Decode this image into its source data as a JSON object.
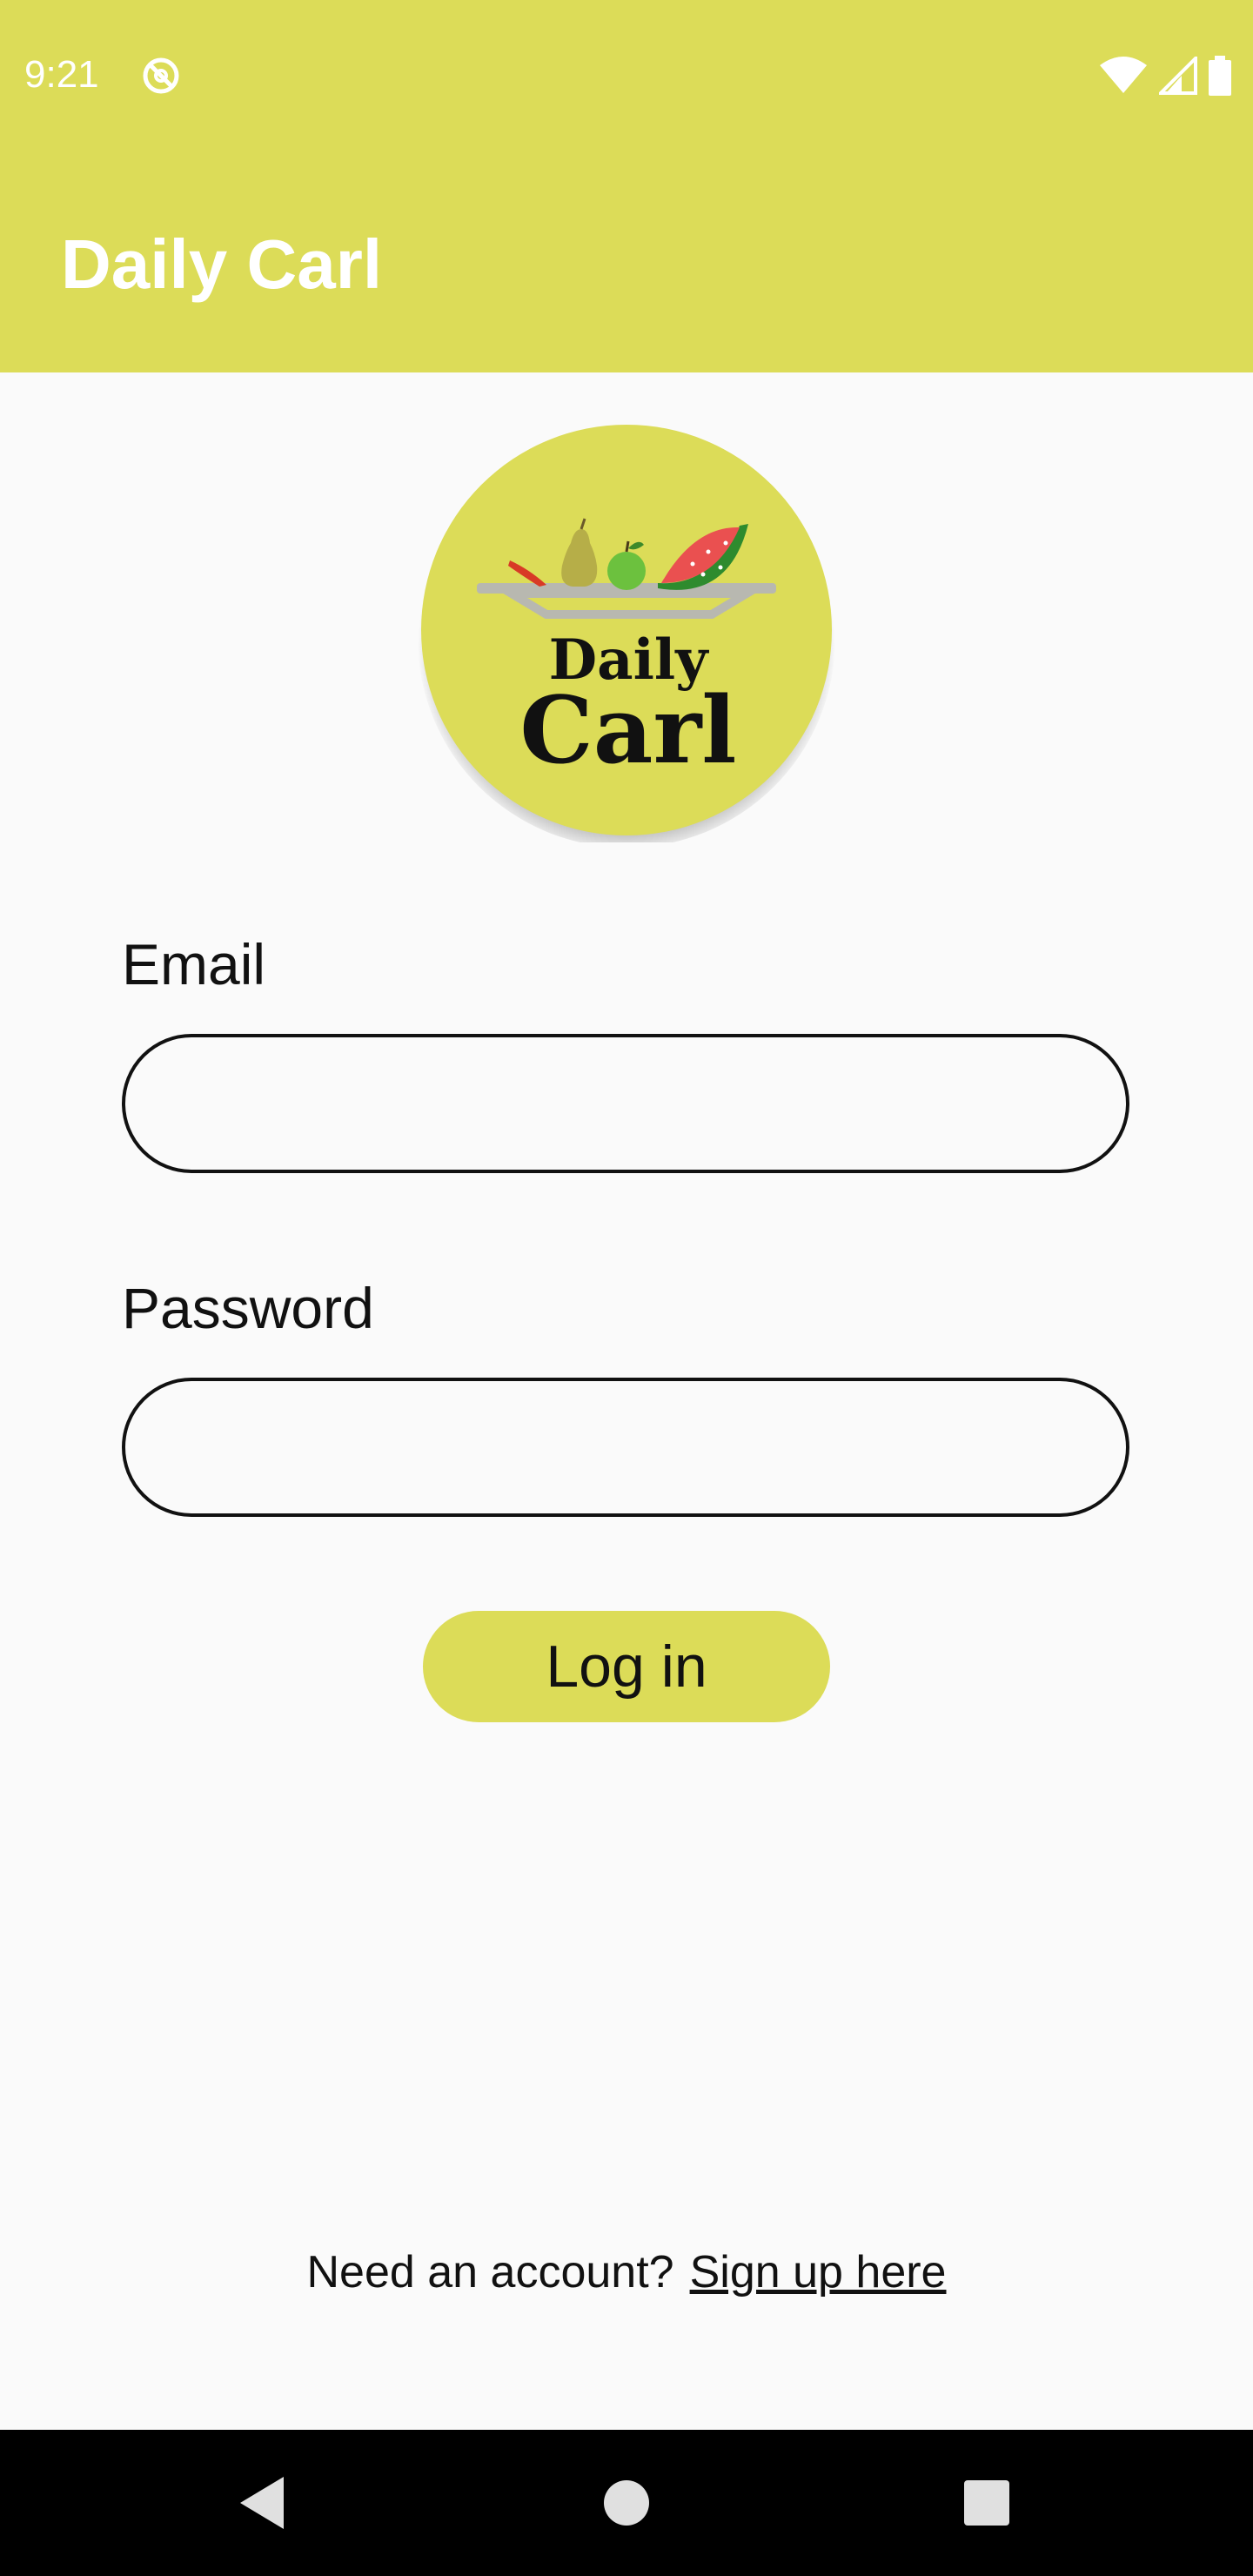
{
  "status_bar": {
    "time": "9:21",
    "app_icon": "sync-disabled-icon",
    "icons": [
      "wifi-icon",
      "cell-signal-icon",
      "battery-icon"
    ],
    "color": "#dcdc58"
  },
  "app_bar": {
    "title": "Daily Carl",
    "color": "#dcdc58"
  },
  "logo": {
    "line1": "Daily",
    "line2": "Carl",
    "color": "#dcdc58"
  },
  "form": {
    "email_label": "Email",
    "email_value": "",
    "password_label": "Password",
    "password_value": "",
    "login_label": "Log in"
  },
  "footer": {
    "prompt": "Need an account?",
    "signup_link": "Sign up here"
  },
  "nav_bar": {
    "buttons": [
      "back-icon",
      "home-icon",
      "recents-icon"
    ]
  }
}
